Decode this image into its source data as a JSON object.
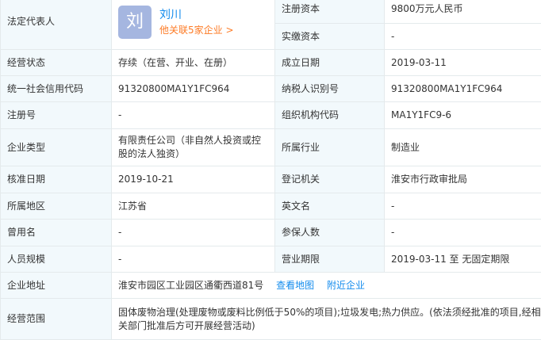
{
  "legal_rep": {
    "label": "法定代表人",
    "avatar_char": "刘",
    "name": "刘川",
    "associated": "他关联5家企业 >"
  },
  "rows": {
    "reg_capital": {
      "label": "注册资本",
      "value": "9800万元人民币"
    },
    "paid_capital": {
      "label": "实缴资本",
      "value": "-"
    },
    "status": {
      "label": "经营状态",
      "value": "存续（在营、开业、在册）"
    },
    "established": {
      "label": "成立日期",
      "value": "2019-03-11"
    },
    "credit_code": {
      "label": "统一社会信用代码",
      "value": "91320800MA1Y1FC964"
    },
    "taxpayer_id": {
      "label": "纳税人识别号",
      "value": "91320800MA1Y1FC964"
    },
    "reg_no": {
      "label": "注册号",
      "value": "-"
    },
    "org_code": {
      "label": "组织机构代码",
      "value": "MA1Y1FC9-6"
    },
    "company_type": {
      "label": "企业类型",
      "value": "有限责任公司（非自然人投资或控股的法人独资）"
    },
    "industry": {
      "label": "所属行业",
      "value": "制造业"
    },
    "approval_date": {
      "label": "核准日期",
      "value": "2019-10-21"
    },
    "authority": {
      "label": "登记机关",
      "value": "淮安市行政审批局"
    },
    "region": {
      "label": "所属地区",
      "value": "江苏省"
    },
    "english_name": {
      "label": "英文名",
      "value": "-"
    },
    "former_name": {
      "label": "曾用名",
      "value": "-"
    },
    "insured": {
      "label": "参保人数",
      "value": "-"
    },
    "staff_size": {
      "label": "人员规模",
      "value": "-"
    },
    "business_term": {
      "label": "营业期限",
      "value": "2019-03-11 至 无固定期限"
    },
    "address": {
      "label": "企业地址",
      "value": "淮安市园区工业园区通衢西道81号",
      "map_link": "查看地图",
      "nearby_link": "附近企业"
    },
    "scope": {
      "label": "经营范围",
      "value": "固体废物治理(处理废物或废料比例低于50%的项目);垃圾发电;热力供应。(依法须经批准的项目,经相关部门批准后方可开展经营活动)"
    }
  }
}
